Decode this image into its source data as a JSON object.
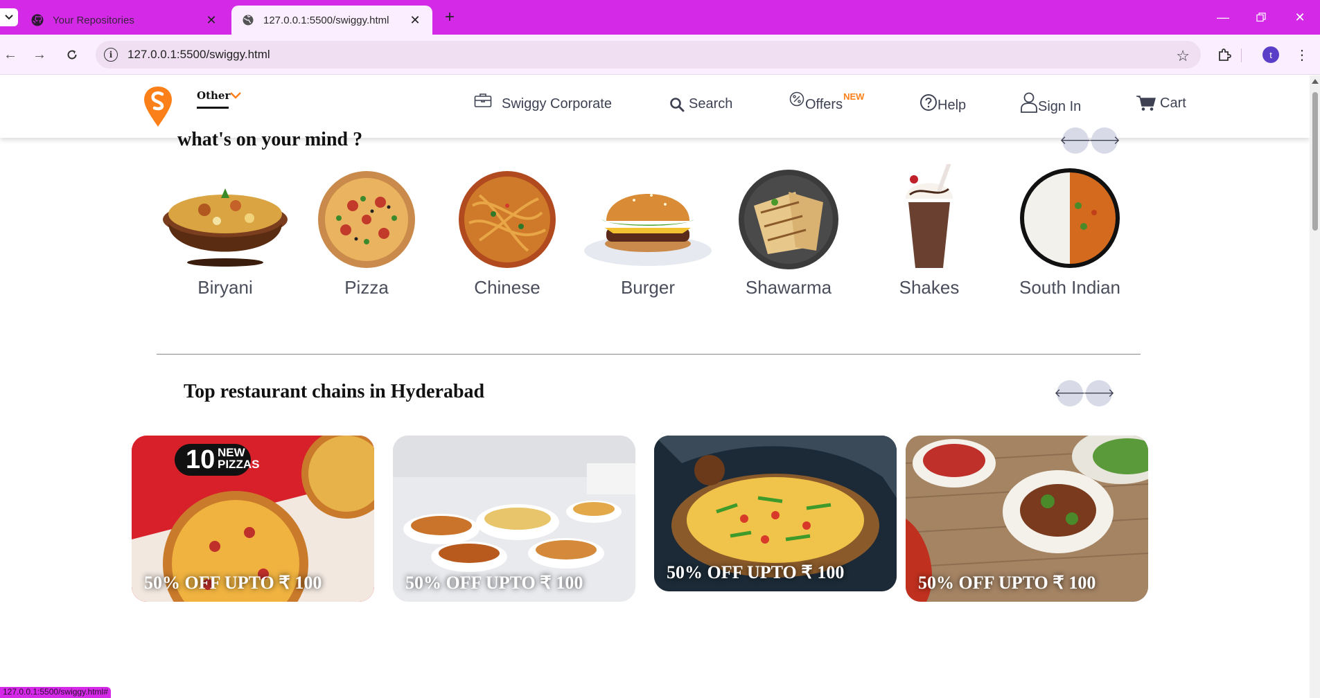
{
  "browser": {
    "tabs": [
      {
        "title": "Your Repositories",
        "active": false
      },
      {
        "title": "127.0.0.1:5500/swiggy.html",
        "active": true
      }
    ],
    "url": "127.0.0.1:5500/swiggy.html",
    "profile_initial": "t",
    "status_url": "127.0.0.1:5500/swiggy.html#"
  },
  "header": {
    "location": "Other",
    "nav": {
      "corporate": "Swiggy Corporate",
      "search": "Search",
      "offers": "Offers",
      "offers_badge": "NEW",
      "help": "Help",
      "signin": "Sign In",
      "cart": "Cart"
    }
  },
  "mind": {
    "title": "what's on your mind ?",
    "items": [
      {
        "label": "Biryani",
        "icon": "biryani-image"
      },
      {
        "label": "Pizza",
        "icon": "pizza-image"
      },
      {
        "label": "Chinese",
        "icon": "noodles-image"
      },
      {
        "label": "Burger",
        "icon": "burger-image"
      },
      {
        "label": "Shawarma",
        "icon": "shawarma-image"
      },
      {
        "label": "Shakes",
        "icon": "shake-image"
      },
      {
        "label": "South Indian",
        "icon": "thali-image"
      }
    ]
  },
  "restaurants": {
    "title": "Top restaurant chains in Hyderabad",
    "cards": [
      {
        "offer": "50% OFF UPTO ₹ 100",
        "badge_num": "10",
        "badge_text1": "NEW",
        "badge_text2": "PIZZAS"
      },
      {
        "offer": "50% OFF UPTO ₹ 100"
      },
      {
        "offer": "50% OFF UPTO ₹ 100"
      },
      {
        "offer": "50% OFF UPTO ₹ 100"
      }
    ]
  },
  "colors": {
    "brand": "#fc8019",
    "chrome": "#d42ae8",
    "arrow_bg": "#d8dae8"
  }
}
